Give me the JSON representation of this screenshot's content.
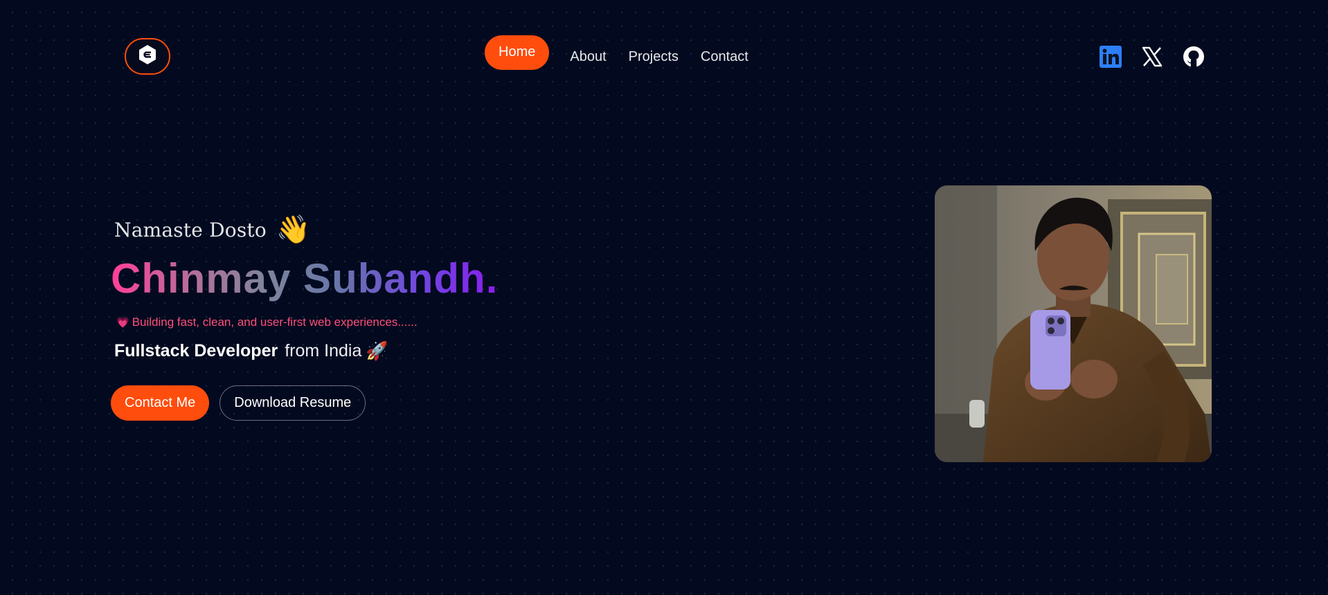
{
  "header": {
    "logo_icon": "hexagon-e-logo-icon",
    "nav": [
      {
        "label": "Home",
        "active": true
      },
      {
        "label": "About",
        "active": false
      },
      {
        "label": "Projects",
        "active": false
      },
      {
        "label": "Contact",
        "active": false
      }
    ],
    "socials": [
      {
        "icon": "linkedin-icon"
      },
      {
        "icon": "x-twitter-icon"
      },
      {
        "icon": "github-icon"
      }
    ]
  },
  "hero": {
    "greeting": "Namaste Dosto",
    "greeting_emoji": "👋",
    "name": "Chinmay Subandh.",
    "tagline_emoji": "💗",
    "tagline": "Building fast, clean, and user-first web experiences......",
    "role_strong": "Fullstack Developer",
    "role_rest": "from India",
    "role_emoji": "🚀",
    "primary_button": "Contact Me",
    "secondary_button": "Download Resume"
  },
  "colors": {
    "background": "#030a1f",
    "accent": "#ff4d0d",
    "tagline": "#ff4f7a",
    "linkedin": "#2d7ff9"
  }
}
